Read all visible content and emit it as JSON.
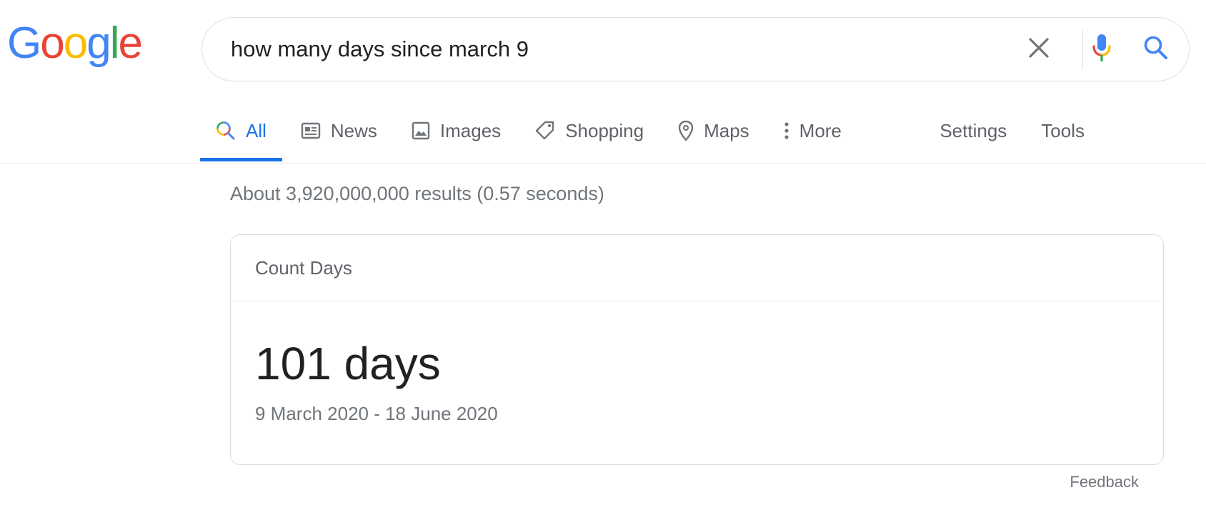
{
  "logo": {
    "letters": [
      "G",
      "o",
      "o",
      "g",
      "l",
      "e"
    ],
    "colors": [
      "#4285F4",
      "#EA4335",
      "#FBBC05",
      "#4285F4",
      "#34A853",
      "#EA4335"
    ]
  },
  "search": {
    "query": "how many days since march 9",
    "icons": [
      "close-icon",
      "mic-icon",
      "search-icon"
    ]
  },
  "tabs": {
    "items": [
      {
        "label": "All",
        "icon": "search-icon",
        "active": true
      },
      {
        "label": "News",
        "icon": "news-icon"
      },
      {
        "label": "Images",
        "icon": "image-icon"
      },
      {
        "label": "Shopping",
        "icon": "tag-icon"
      },
      {
        "label": "Maps",
        "icon": "map-pin-icon"
      },
      {
        "label": "More",
        "icon": "more-vert-icon"
      }
    ],
    "settings": "Settings",
    "tools": "Tools"
  },
  "results": {
    "stats": "About 3,920,000,000 results (0.57 seconds)"
  },
  "card": {
    "title": "Count Days",
    "value": "101 days",
    "range": "9 March 2020 - 18 June 2020"
  },
  "feedback": "Feedback",
  "colors": {
    "accent": "#1a73e8",
    "text_secondary": "#5f6368",
    "border": "#dfe1e5"
  }
}
